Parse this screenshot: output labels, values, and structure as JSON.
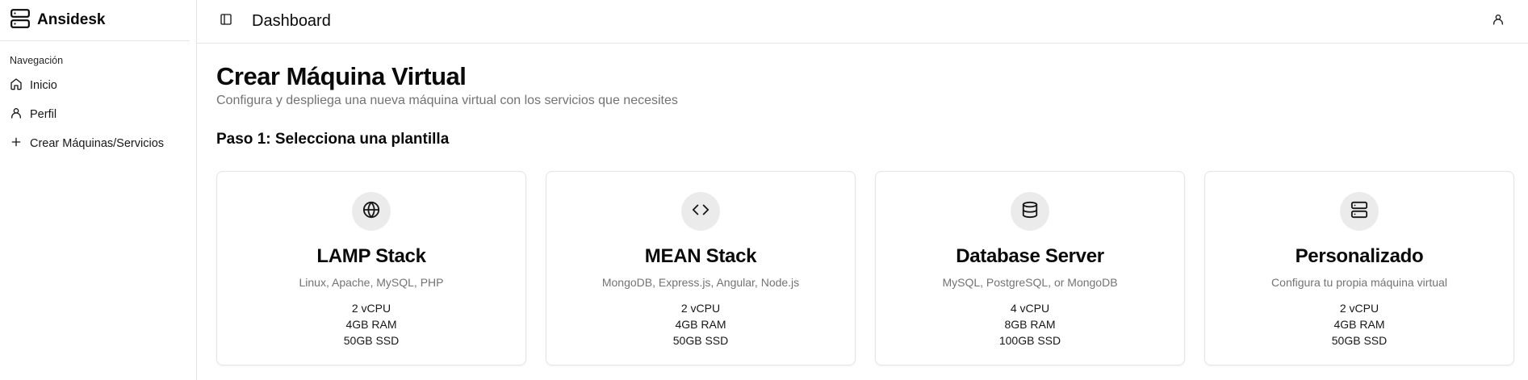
{
  "app": {
    "name": "Ansidesk"
  },
  "sidebar": {
    "group_label": "Navegación",
    "items": [
      {
        "label": "Inicio",
        "icon": "home-icon"
      },
      {
        "label": "Perfil",
        "icon": "user-icon"
      },
      {
        "label": "Crear Máquinas/Servicios",
        "icon": "plus-icon"
      }
    ]
  },
  "header": {
    "title": "Dashboard"
  },
  "page": {
    "title": "Crear Máquina Virtual",
    "subtitle": "Configura y despliega una nueva máquina virtual con los servicios que necesites",
    "step_title": "Paso 1: Selecciona una plantilla"
  },
  "templates": [
    {
      "icon": "globe-icon",
      "title": "LAMP Stack",
      "description": "Linux, Apache, MySQL, PHP",
      "cpu": "2 vCPU",
      "ram": "4GB RAM",
      "disk": "50GB SSD"
    },
    {
      "icon": "code-icon",
      "title": "MEAN Stack",
      "description": "MongoDB, Express.js, Angular, Node.js",
      "cpu": "2 vCPU",
      "ram": "4GB RAM",
      "disk": "50GB SSD"
    },
    {
      "icon": "database-icon",
      "title": "Database Server",
      "description": "MySQL, PostgreSQL, or MongoDB",
      "cpu": "4 vCPU",
      "ram": "8GB RAM",
      "disk": "100GB SSD"
    },
    {
      "icon": "server-icon",
      "title": "Personalizado",
      "description": "Configura tu propia máquina virtual",
      "cpu": "2 vCPU",
      "ram": "4GB RAM",
      "disk": "50GB SSD"
    }
  ]
}
